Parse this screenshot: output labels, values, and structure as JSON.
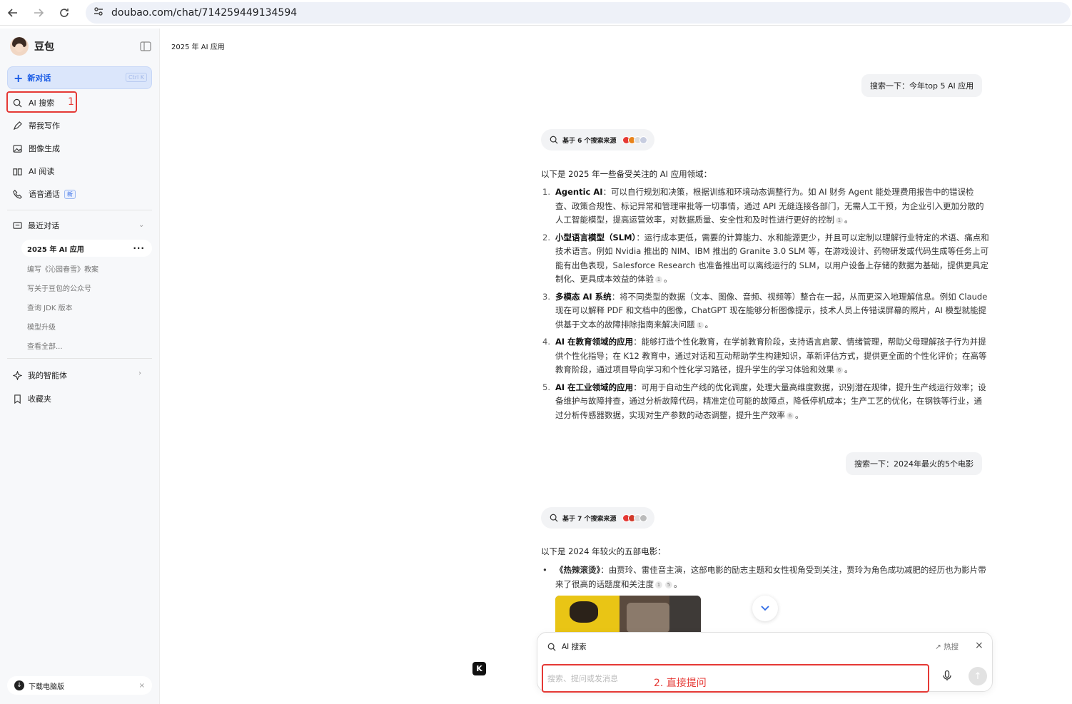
{
  "browser": {
    "url": "doubao.com/chat/714259449134594"
  },
  "sidebar": {
    "brand": "豆包",
    "new_chat": {
      "label": "新对话",
      "shortcut": "Ctrl K"
    },
    "menu": [
      {
        "label": "AI 搜索",
        "icon": "search-icon"
      },
      {
        "label": "帮我写作",
        "icon": "pen-icon"
      },
      {
        "label": "图像生成",
        "icon": "image-icon"
      },
      {
        "label": "AI 阅读",
        "icon": "book-icon"
      },
      {
        "label": "语音通话",
        "icon": "phone-icon",
        "badge": "新"
      }
    ],
    "annotation_1": "1",
    "recent": {
      "header": "最近对话",
      "active": "2025 年 AI 应用",
      "items": [
        "编写《沁园春雪》教案",
        "写关于豆包的公众号",
        "查询 JDK 版本",
        "模型升级",
        "查看全部..."
      ]
    },
    "agents": "我的智能体",
    "favorites": "收藏夹",
    "download": "下载电脑版"
  },
  "main": {
    "chat_title": "2025 年 AI 应用",
    "q1": "搜索一下：今年top 5 AI 应用",
    "sources1": "基于 6 个搜索来源",
    "intro1": "以下是 2025 年一些备受关注的 AI 应用领域：",
    "answers": [
      {
        "num": "1.",
        "title": "Agentic AI",
        "text": "：可以自行规划和决策，根据训练和环境动态调整行为。如 AI 财务 Agent 能处理费用报告中的错误检查、政策合规性、标记异常和管理审批等一切事情，通过 API 无缝连接各部门，无需人工干预，为企业引入更加分散的人工智能模型，提高运营效率，对数据质量、安全性和及时性进行更好的控制",
        "cite": "1",
        "end": "。"
      },
      {
        "num": "2.",
        "title": "小型语言模型（SLM）",
        "text": "：运行成本更低，需要的计算能力、水和能源更少，并且可以定制以理解行业特定的术语、痛点和技术语言。例如 Nvidia 推出的 NIM、IBM 推出的 Granite 3.0 SLM 等，在游戏设计、药物研发或代码生成等任务上可能有出色表现，Salesforce Research 也准备推出可以离线运行的 SLM，以用户设备上存储的数据为基础，提供更具定制化、更具成本效益的体验",
        "cite": "1",
        "end": "。"
      },
      {
        "num": "3.",
        "title": "多模态 AI 系统",
        "text": "：将不同类型的数据（文本、图像、音频、视频等）整合在一起，从而更深入地理解信息。例如 Claude 现在可以解释 PDF 和文档中的图像，ChatGPT 现在能够分析图像提示，技术人员上传错误屏幕的照片，AI 模型就能提供基于文本的故障排除指南来解决问题",
        "cite": "1",
        "end": "。"
      },
      {
        "num": "4.",
        "title": "AI 在教育领域的应用",
        "text": "：能够打造个性化教育，在学前教育阶段，支持语言启蒙、情绪管理，帮助父母理解孩子行为并提供个性化指导；在 K12 教育中，通过对话和互动帮助学生构建知识，革新评估方式，提供更全面的个性化评价；在高等教育阶段，通过项目导向学习和个性化学习路径，提升学生的学习体验和效果",
        "cite": "6",
        "end": "。"
      },
      {
        "num": "5.",
        "title": "AI 在工业领域的应用",
        "text": "：可用于自动生产线的优化调度，处理大量高维度数据，识别潜在规律，提升生产线运行效率；设备维护与故障排查，通过分析故障代码，精准定位可能的故障点，降低停机成本；生产工艺的优化，在钢铁等行业，通过分析传感器数据，实现对生产参数的动态调整，提升生产效率",
        "cite": "6",
        "end": "。"
      }
    ],
    "q2": "搜索一下：2024年最火的5个电影",
    "sources2": "基于 7 个搜索来源",
    "intro2": "以下是 2024 年较火的五部电影：",
    "movie1": {
      "title": "《热辣滚烫》",
      "text": "：由贾玲、雷佳音主演，这部电影的励志主题和女性视角受到关注，贾玲为角色成功减肥的经历也为影片带来了很高的话题度和关注度",
      "cites": [
        "1",
        "5"
      ],
      "end": "。"
    }
  },
  "composer": {
    "mode": "AI 搜索",
    "hot": "热搜",
    "placeholder": "搜索、提问或发消息",
    "annotation_2": "2. 直接提问"
  },
  "colors": {
    "accent": "#1a5ce6",
    "annotation": "#e53935"
  }
}
